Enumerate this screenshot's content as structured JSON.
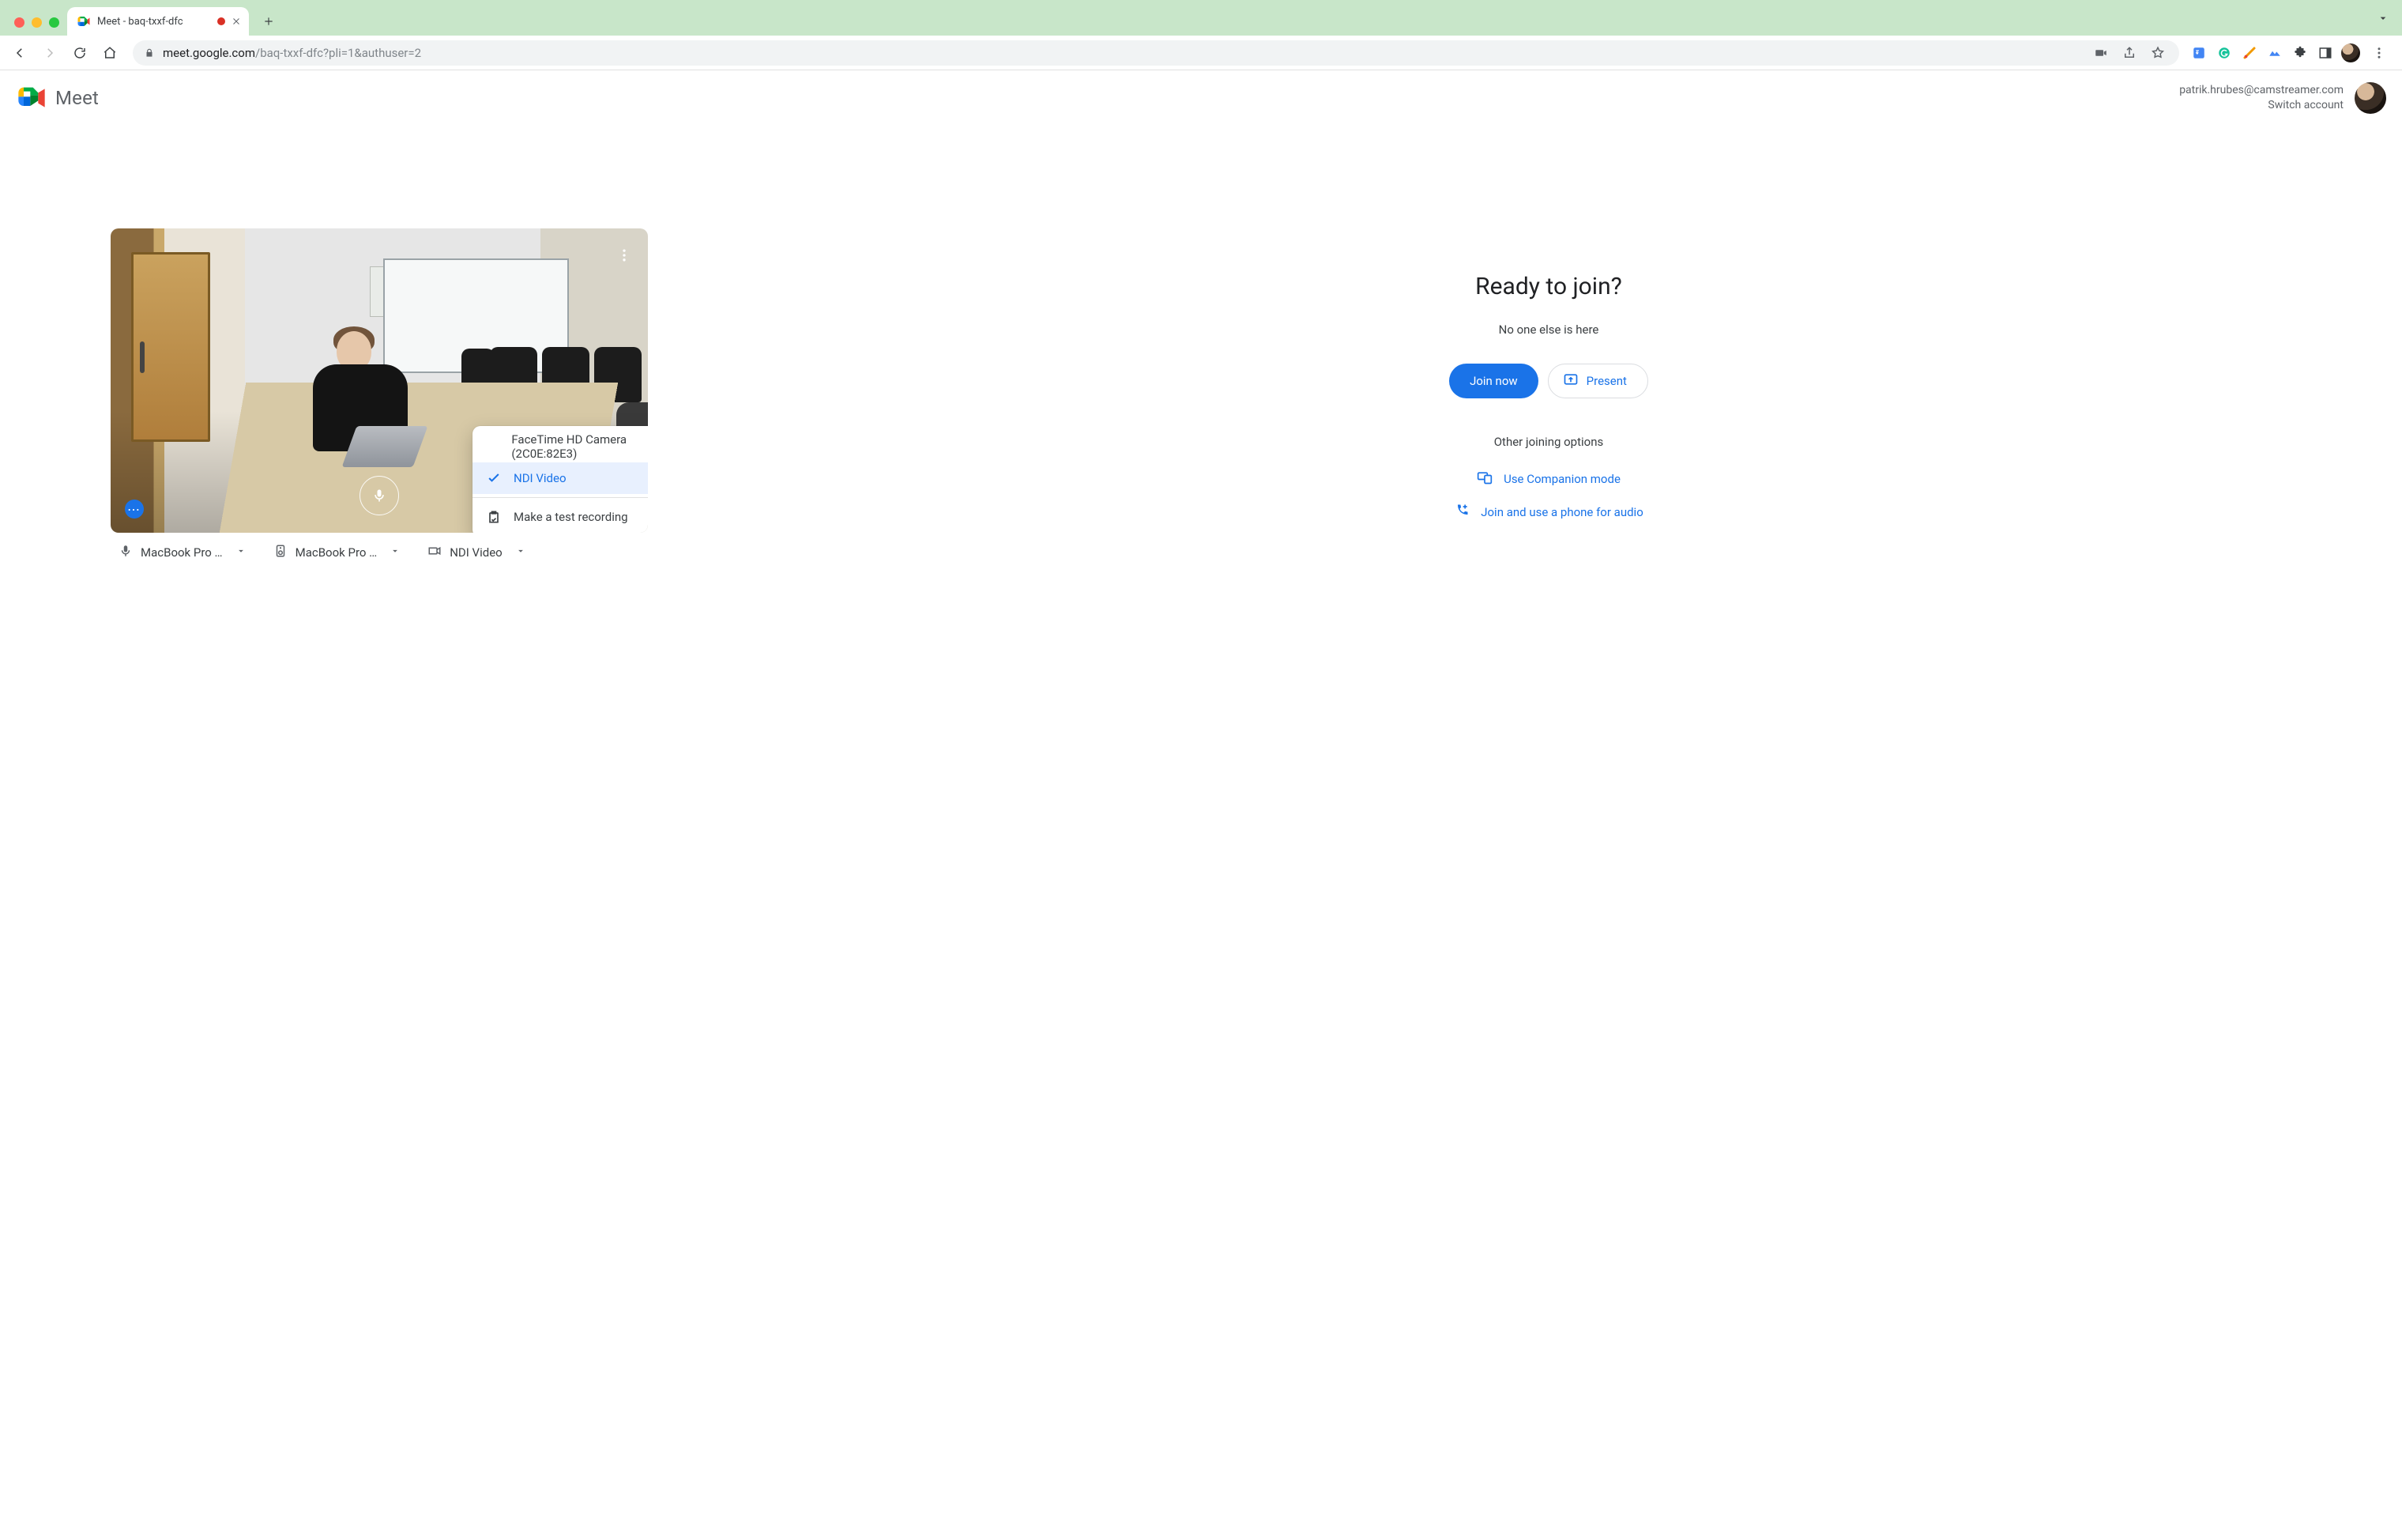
{
  "chrome": {
    "tab_title": "Meet - baq-txxf-dfc",
    "url_host": "meet.google.com",
    "url_path": "/baq-txxf-dfc?pli=1&authuser=2"
  },
  "header": {
    "brand": "Meet",
    "account_email": "patrik.hrubes@camstreamer.com",
    "switch_account": "Switch account"
  },
  "devices": {
    "mic_label": "MacBook Pro …",
    "speaker_label": "MacBook Pro …",
    "camera_label": "NDI Video"
  },
  "camera_menu": {
    "option_1": "FaceTime HD Camera (2C0E:82E3)",
    "option_2": "NDI Video",
    "action_test_recording": "Make a test recording"
  },
  "right": {
    "title": "Ready to join?",
    "status": "No one else is here",
    "join_label": "Join now",
    "present_label": "Present",
    "other_title": "Other joining options",
    "companion_label": "Use Companion mode",
    "phone_label": "Join and use a phone for audio"
  }
}
